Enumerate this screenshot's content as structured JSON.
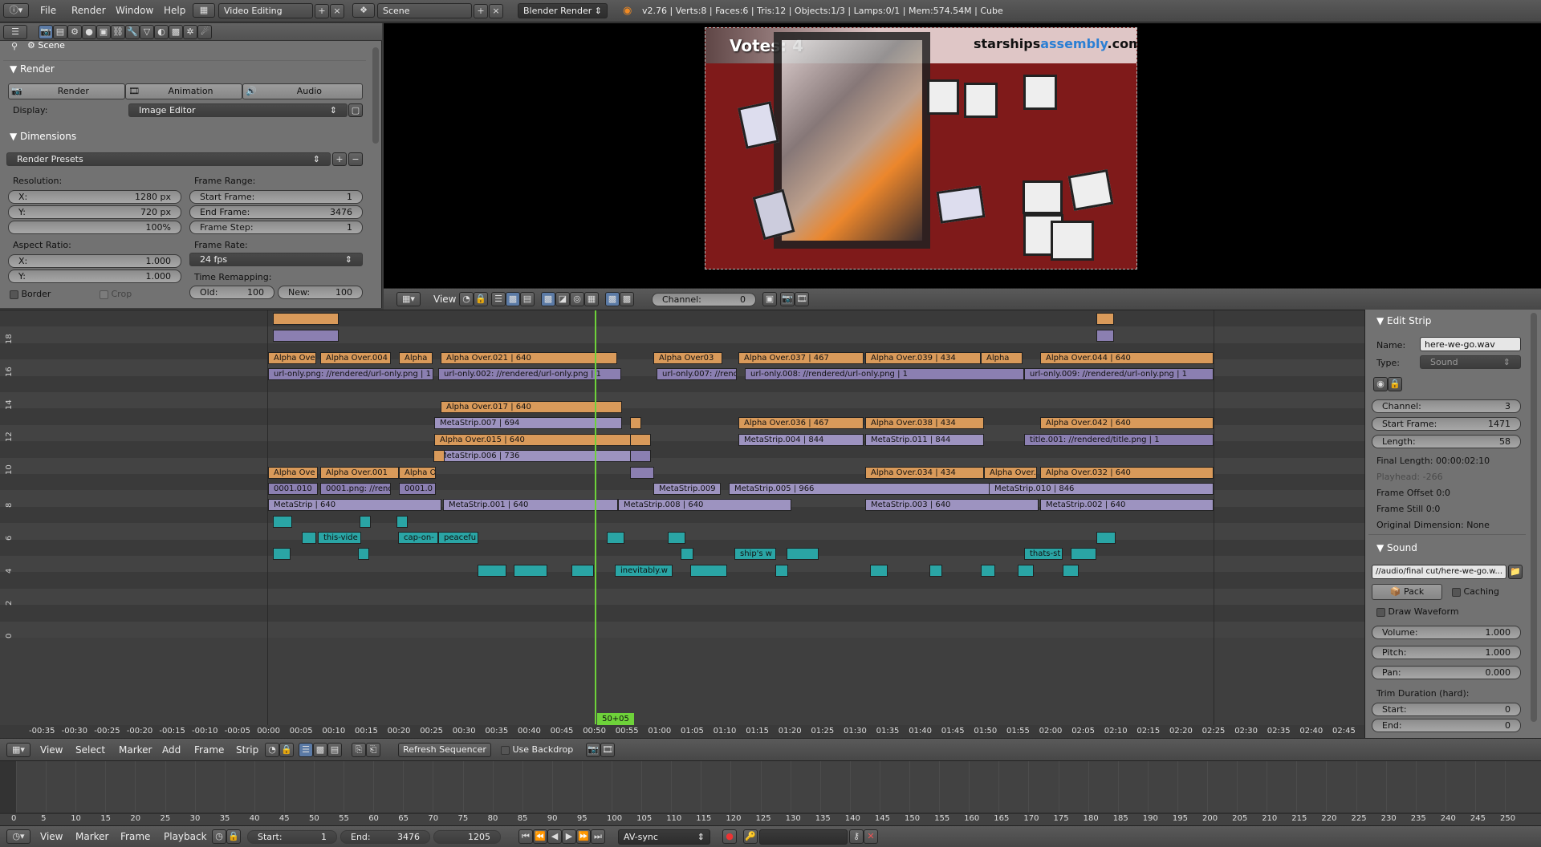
{
  "topbar": {
    "menus": [
      "File",
      "Render",
      "Window",
      "Help"
    ],
    "screen_layout": "Video Editing",
    "scene": "Scene",
    "engine": "Blender Render",
    "status": "v2.76 | Verts:8 | Faces:6 | Tris:12 | Objects:1/3 | Lamps:0/1 | Mem:574.54M | Cube"
  },
  "props": {
    "breadcrumb": "Scene",
    "render_panel": "Render",
    "render_buttons": [
      "Render",
      "Animation",
      "Audio"
    ],
    "display_label": "Display:",
    "display_value": "Image Editor",
    "dimensions_panel": "Dimensions",
    "presets": "Render Presets",
    "resolution_label": "Resolution:",
    "res_x": {
      "label": "X:",
      "value": "1280 px"
    },
    "res_y": {
      "label": "Y:",
      "value": "720 px"
    },
    "res_pct": "100%",
    "frame_range_label": "Frame Range:",
    "start_frame": {
      "label": "Start Frame:",
      "value": "1"
    },
    "end_frame": {
      "label": "End Frame:",
      "value": "3476"
    },
    "frame_step": {
      "label": "Frame Step:",
      "value": "1"
    },
    "aspect_label": "Aspect Ratio:",
    "asp_x": {
      "label": "X:",
      "value": "1.000"
    },
    "asp_y": {
      "label": "Y:",
      "value": "1.000"
    },
    "frame_rate_label": "Frame Rate:",
    "frame_rate": "24 fps",
    "time_remap_label": "Time Remapping:",
    "old": {
      "label": "Old:",
      "value": "100"
    },
    "new": {
      "label": "New:",
      "value": "100"
    },
    "border": "Border",
    "crop": "Crop"
  },
  "preview": {
    "votes": "Votes: 4",
    "brand_a": "starships",
    "brand_b": "assembly",
    "brand_c": ".com"
  },
  "prev_header": {
    "view": "View",
    "channel_label": "Channel:",
    "channel_value": "0"
  },
  "sequencer": {
    "channel_numbers": [
      "18",
      "16",
      "14",
      "12",
      "10",
      "8",
      "6",
      "4",
      "2",
      "0"
    ],
    "playhead": "50+05",
    "strips": [
      {
        "cls": "orange",
        "label": "Alpha Ove"
      },
      {
        "cls": "orange",
        "label": "Alpha Over.004"
      },
      {
        "cls": "orange",
        "label": "Alpha"
      },
      {
        "cls": "orange",
        "label": "Alpha Over.021 | 640"
      },
      {
        "cls": "orange",
        "label": "Alpha Over03"
      },
      {
        "cls": "orange",
        "label": "Alpha Over.037 | 467"
      },
      {
        "cls": "orange",
        "label": "Alpha Over.039 | 434"
      },
      {
        "cls": "orange",
        "label": "Alpha"
      },
      {
        "cls": "orange",
        "label": "Alpha Over.044 | 640"
      },
      {
        "cls": "purple",
        "label": "url-only.png: //rendered/url-only.png | 1"
      },
      {
        "cls": "purple",
        "label": "url-only.002: //rendered/url-only.png | 1"
      },
      {
        "cls": "purple",
        "label": "url-only.007: //rend"
      },
      {
        "cls": "purple",
        "label": "url-only.008: //rendered/url-only.png | 1"
      },
      {
        "cls": "purple",
        "label": "url-only.009: //rendered/url-only.png | 1"
      },
      {
        "cls": "orange",
        "label": "Alpha Over.017 | 640"
      },
      {
        "cls": "lightpurple",
        "label": "MetaStrip.007 | 694"
      },
      {
        "cls": "orange",
        "label": "Alpha Over.036 | 467"
      },
      {
        "cls": "orange",
        "label": "Alpha Over.038 | 434"
      },
      {
        "cls": "orange",
        "label": "Alpha Over.042 | 640"
      },
      {
        "cls": "orange",
        "label": "Alpha Over.015 | 640"
      },
      {
        "cls": "lightpurple",
        "label": "MetaStrip.004 | 844"
      },
      {
        "cls": "lightpurple",
        "label": "MetaStrip.011 | 844"
      },
      {
        "cls": "purple",
        "label": "title.001: //rendered/title.png | 1"
      },
      {
        "cls": "lightpurple",
        "label": "MetaStrip.006 | 736"
      },
      {
        "cls": "orange",
        "label": "Alpha Ove"
      },
      {
        "cls": "orange",
        "label": "Alpha Over.001"
      },
      {
        "cls": "orange",
        "label": "Alpha O"
      },
      {
        "cls": "orange",
        "label": "Alpha Over.034 | 434"
      },
      {
        "cls": "orange",
        "label": "Alpha Over."
      },
      {
        "cls": "orange",
        "label": "Alpha Over.032 | 640"
      },
      {
        "cls": "purple",
        "label": "0001.010"
      },
      {
        "cls": "purple",
        "label": "0001.png: //rend"
      },
      {
        "cls": "purple",
        "label": "0001.0"
      },
      {
        "cls": "lightpurple",
        "label": "MetaStrip.009"
      },
      {
        "cls": "lightpurple",
        "label": "MetaStrip.005 | 966"
      },
      {
        "cls": "lightpurple",
        "label": "MetaStrip.010 | 846"
      },
      {
        "cls": "lightpurple",
        "label": "MetaStrip | 640"
      },
      {
        "cls": "lightpurple",
        "label": "MetaStrip.001 | 640"
      },
      {
        "cls": "lightpurple",
        "label": "MetaStrip.008 | 640"
      },
      {
        "cls": "lightpurple",
        "label": "MetaStrip.003 | 640"
      },
      {
        "cls": "lightpurple",
        "label": "MetaStrip.002 | 640"
      },
      {
        "cls": "teal",
        "label": "this-vide"
      },
      {
        "cls": "teal",
        "label": "cap-on-"
      },
      {
        "cls": "teal",
        "label": "peacefu"
      },
      {
        "cls": "teal",
        "label": "ship's w"
      },
      {
        "cls": "teal",
        "label": "thats-st"
      },
      {
        "cls": "teal",
        "label": "inevitably.w"
      }
    ],
    "ruler": [
      "-00:35",
      "-00:30",
      "-00:25",
      "-00:20",
      "-00:15",
      "-00:10",
      "-00:05",
      "00:00",
      "00:05",
      "00:10",
      "00:15",
      "00:20",
      "00:25",
      "00:30",
      "00:35",
      "00:40",
      "00:45",
      "00:50",
      "00:55",
      "01:00",
      "01:05",
      "01:10",
      "01:15",
      "01:20",
      "01:25",
      "01:30",
      "01:35",
      "01:40",
      "01:45",
      "01:50",
      "01:55",
      "02:00",
      "02:05",
      "02:10",
      "02:15",
      "02:20",
      "02:25",
      "02:30",
      "02:35",
      "02:40",
      "02:45"
    ]
  },
  "seq_header": {
    "menus": [
      "View",
      "Select",
      "Marker",
      "Add",
      "Frame",
      "Strip"
    ],
    "refresh": "Refresh Sequencer",
    "backdrop": "Use Backdrop"
  },
  "edit_strip": {
    "title": "Edit Strip",
    "name_label": "Name:",
    "name_value": "here-we-go.wav",
    "type_label": "Type:",
    "type_value": "Sound",
    "channel": {
      "label": "Channel:",
      "value": "3"
    },
    "start": {
      "label": "Start Frame:",
      "value": "1471"
    },
    "length": {
      "label": "Length:",
      "value": "58"
    },
    "final_length": "Final Length: 00:00:02:10",
    "playhead": "Playhead: -266",
    "frame_offset": "Frame Offset 0:0",
    "frame_still": "Frame Still 0:0",
    "orig_dim": "Original Dimension: None",
    "sound_title": "Sound",
    "sound_path": "//audio/final cut/here-we-go.w...",
    "pack": "Pack",
    "caching": "Caching",
    "draw_waveform": "Draw Waveform",
    "volume": {
      "label": "Volume:",
      "value": "1.000"
    },
    "pitch": {
      "label": "Pitch:",
      "value": "1.000"
    },
    "pan": {
      "label": "Pan:",
      "value": "0.000"
    },
    "trim_label": "Trim Duration (hard):",
    "trim_start": {
      "label": "Start:",
      "value": "0"
    },
    "trim_end": {
      "label": "End:",
      "value": "0"
    }
  },
  "timeline": {
    "ticks": [
      "0",
      "5",
      "10",
      "15",
      "20",
      "25",
      "30",
      "35",
      "40",
      "45",
      "50",
      "55",
      "60",
      "65",
      "70",
      "75",
      "80",
      "85",
      "90",
      "95",
      "100",
      "105",
      "110",
      "115",
      "120",
      "125",
      "130",
      "135",
      "140",
      "145",
      "150",
      "155",
      "160",
      "165",
      "170",
      "175",
      "180",
      "185",
      "190",
      "195",
      "200",
      "205",
      "210",
      "215",
      "220",
      "225",
      "230",
      "235",
      "240",
      "245",
      "250"
    ],
    "menus": [
      "View",
      "Marker",
      "Frame",
      "Playback"
    ],
    "start": {
      "label": "Start:",
      "value": "1"
    },
    "end": {
      "label": "End:",
      "value": "3476"
    },
    "current": "1205",
    "sync": "AV-sync"
  }
}
